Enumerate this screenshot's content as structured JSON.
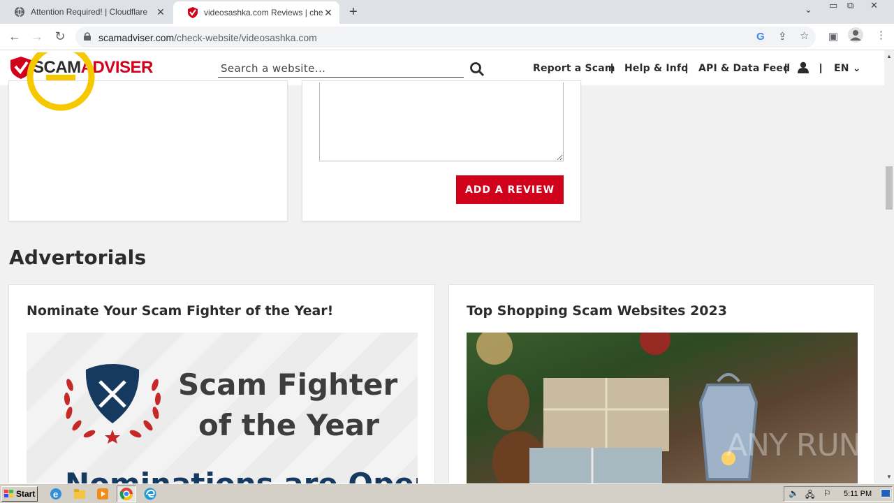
{
  "browser": {
    "tabs": [
      {
        "title": "Attention Required! | Cloudflare"
      },
      {
        "title": "videosashka.com Reviews | check if"
      }
    ],
    "url_host": "scamadviser.com",
    "url_path": "/check-website/videosashka.com"
  },
  "site": {
    "logo_scam": "SCAM",
    "logo_adviser": "ADVISER",
    "search_placeholder": "Search a website...",
    "nav": {
      "report": "Report a Scam",
      "help": "Help & Info",
      "api": "API & Data Feed",
      "lang": "EN"
    }
  },
  "review": {
    "button_label": "ADD A REVIEW"
  },
  "advertorials": {
    "heading": "Advertorials",
    "items": [
      {
        "title": "Nominate Your Scam Fighter of the Year!",
        "image_line1": "Scam Fighter",
        "image_line2": "of the Year",
        "image_line3": "Nominations are Open"
      },
      {
        "title": "Top Shopping Scam Websites 2023"
      }
    ]
  },
  "taskbar": {
    "start_label": "Start",
    "clock": "5:11 PM"
  },
  "watermark": "ANY RUN",
  "colors": {
    "brand_red": "#d0021b",
    "dark_text": "#2b2b2b",
    "smiley_yellow": "#f5c800",
    "navy": "#163a5f"
  }
}
